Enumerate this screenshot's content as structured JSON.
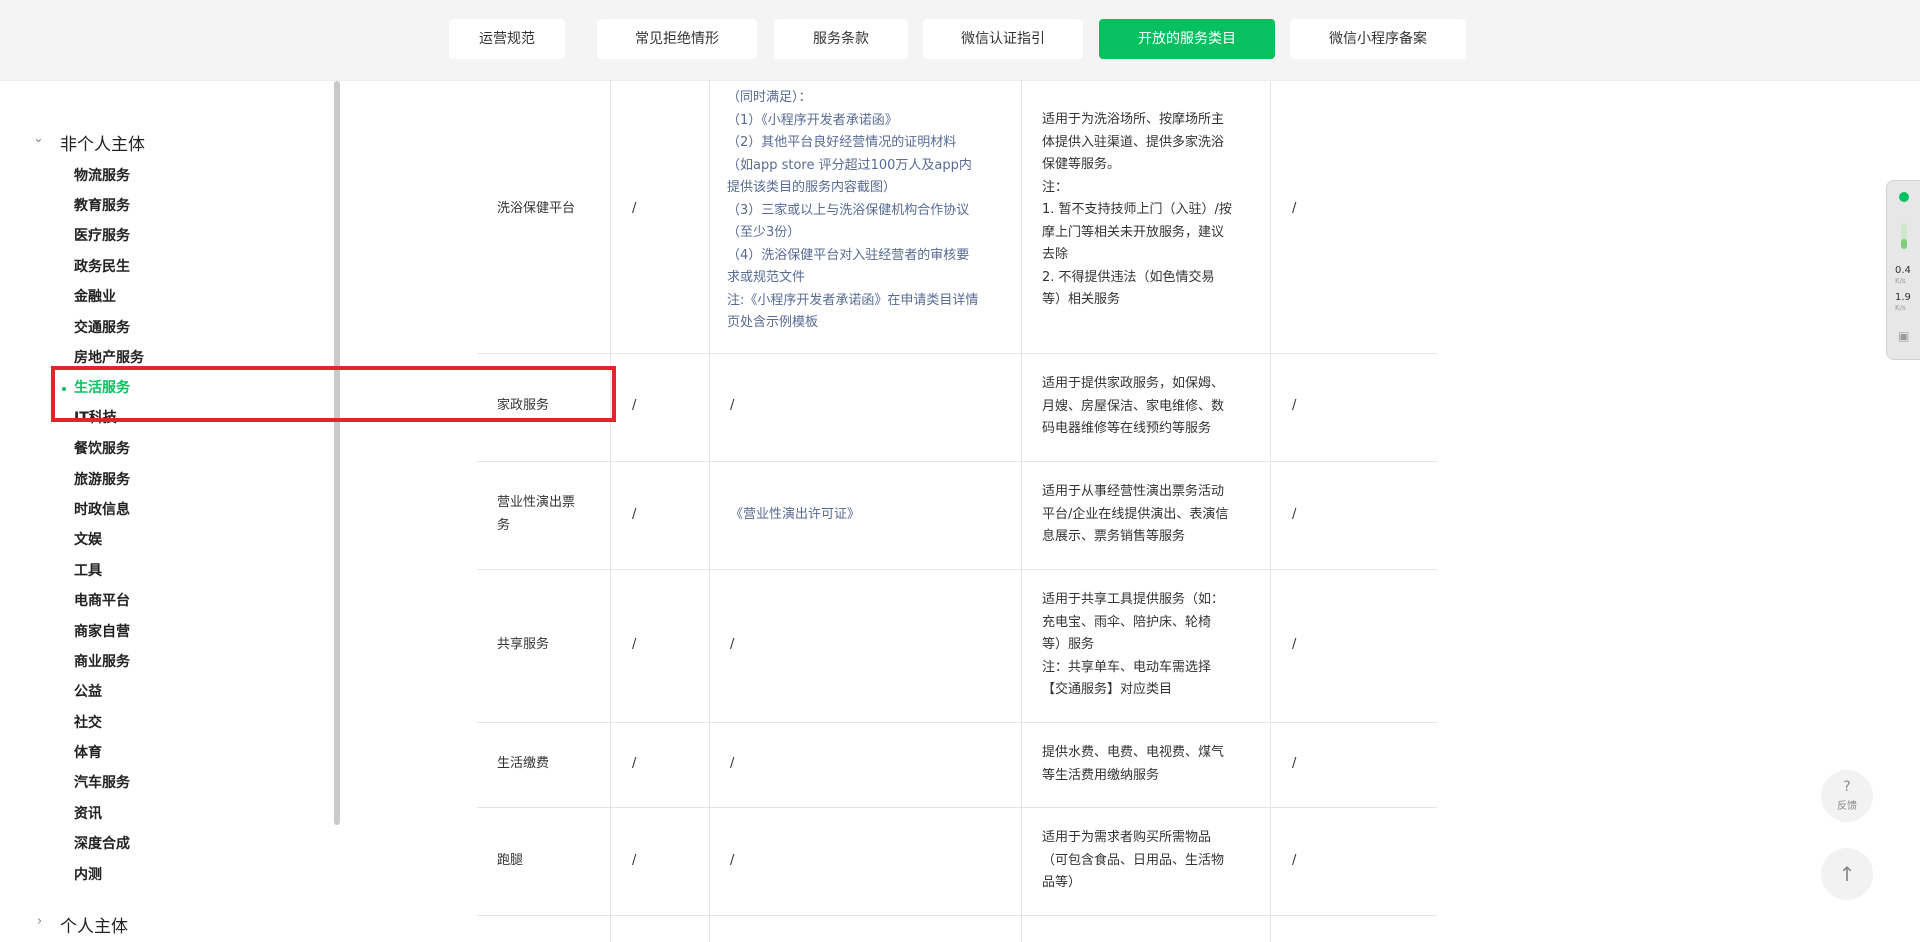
{
  "tabs": [
    {
      "label": "运营规范",
      "active": false
    },
    {
      "label": "常见拒绝情形",
      "active": false
    },
    {
      "label": "服务条款",
      "active": false
    },
    {
      "label": "微信认证指引",
      "active": false
    },
    {
      "label": "开放的服务类目",
      "active": true
    },
    {
      "label": "微信小程序备案",
      "active": false
    }
  ],
  "sidebar": {
    "group_expanded": "非个人主体",
    "group_collapsed": "个人主体",
    "active_item": "生活服务",
    "items": [
      "物流服务",
      "教育服务",
      "医疗服务",
      "政务民生",
      "金融业",
      "交通服务",
      "房地产服务",
      "生活服务",
      "IT科技",
      "餐饮服务",
      "旅游服务",
      "时政信息",
      "文娱",
      "工具",
      "电商平台",
      "商家自营",
      "商业服务",
      "公益",
      "社交",
      "体育",
      "汽车服务",
      "资讯",
      "深度合成",
      "内测"
    ]
  },
  "table": {
    "rows": [
      {
        "name": "洗浴保健平台",
        "col2": "/",
        "col3": "（同时满足）：\n（1）《小程序开发者承诺函》\n（2）其他平台良好经营情况的证明材料\n（如app store 评分超过100万人及app内\n提供该类目的服务内容截图）\n（3）三家或以上与洗浴保健机构合作协议\n（至少3份）\n（4）洗浴保健平台对入驻经营者的审核要\n求或规范文件\n注:《小程序开发者承诺函》在申请类目详情\n页处含示例模板",
        "desc": "适用于为洗浴场所、按摩场所主\n体提供入驻渠道、提供多家洗浴\n保健等服务。\n注：\n1. 暂不支持技师上门（入驻）/按\n摩上门等相关未开放服务，建议\n去除\n2. 不得提供违法（如色情交易\n等）相关服务",
        "col5": "/"
      },
      {
        "name": "家政服务",
        "col2": "/",
        "col3": "/",
        "desc": "适用于提供家政服务，如保姆、\n月嫂、房屋保洁、家电维修、数\n码电器维修等在线预约等服务",
        "col5": "/"
      },
      {
        "name": "营业性演出票\n务",
        "col2": "/",
        "col3": "《营业性演出许可证》",
        "desc": "适用于从事经营性演出票务活动\n平台/企业在线提供演出、表演信\n息展示、票务销售等服务",
        "col5": "/"
      },
      {
        "name": "共享服务",
        "col2": "/",
        "col3": "/",
        "desc": "适用于共享工具提供服务（如：\n充电宝、雨伞、陪护床、轮椅\n等）服务\n注：共享单车、电动车需选择\n【交通服务】对应类目",
        "col5": "/"
      },
      {
        "name": "生活缴费",
        "col2": "/",
        "col3": "/",
        "desc": "提供水费、电费、电视费、煤气\n等生活费用缴纳服务",
        "col5": "/"
      },
      {
        "name": "跑腿",
        "col2": "/",
        "col3": "/",
        "desc": "适用于为需求者购买所需物品\n（可包含食品、日用品、生活物\n品等）",
        "col5": "/"
      }
    ]
  },
  "widget": {
    "upload_speed": "0.4",
    "download_speed": "1.9",
    "unit": "K/s"
  },
  "feedback": {
    "icon": "?",
    "label": "反馈"
  },
  "back_to_top_icon": "↑",
  "colors": {
    "accent": "#07c160",
    "highlight": "#e0262c",
    "link": "#576b95"
  }
}
